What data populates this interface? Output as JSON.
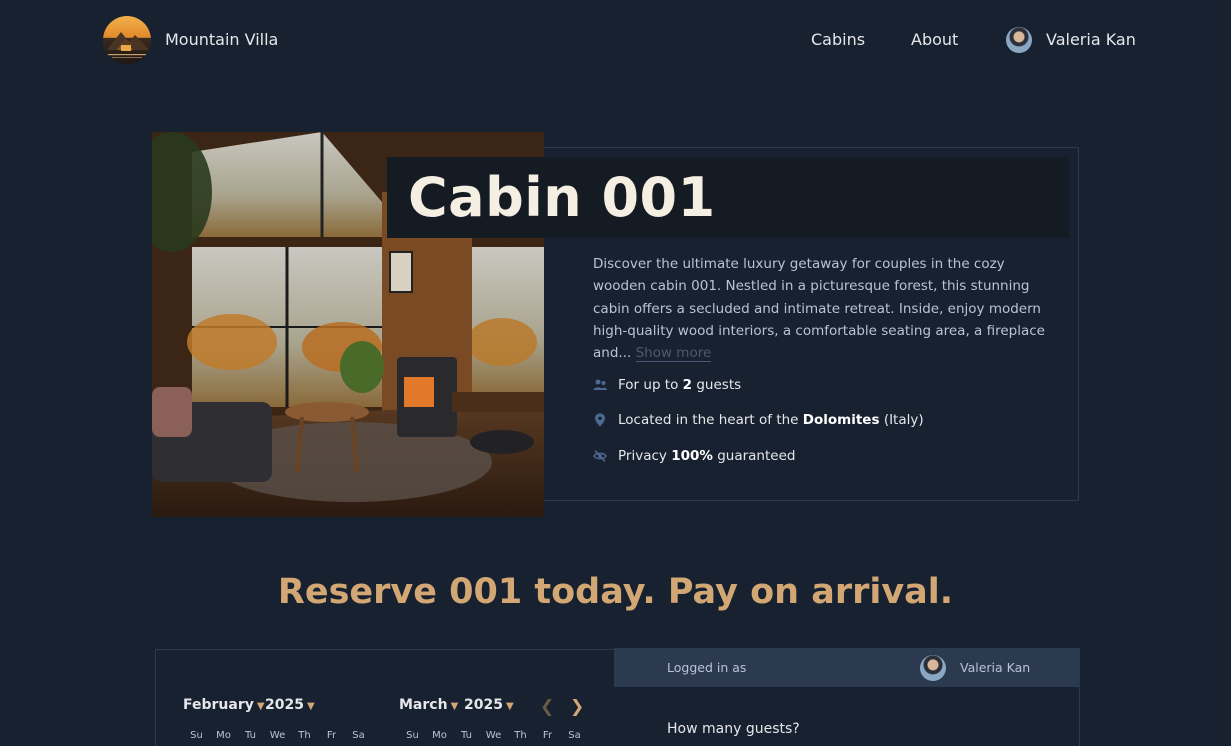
{
  "header": {
    "brand": "Mountain Villa",
    "nav": {
      "cabins": "Cabins",
      "about": "About"
    },
    "user_name": "Valeria Kan"
  },
  "cabin": {
    "title": "Cabin 001",
    "description": "Discover the ultimate luxury getaway for couples in the cozy wooden cabin 001. Nestled in a picturesque forest, this stunning cabin offers a secluded and intimate retreat. Inside, enjoy modern high-quality wood interiors, a comfortable seating area, a fireplace and...",
    "show_more": "Show more",
    "features": {
      "guests": {
        "prefix": "For up to",
        "value": "2",
        "suffix": "guests",
        "icon": "users-icon"
      },
      "location": {
        "prefix": "Located in the heart of the",
        "value": "Dolomites",
        "suffix": "(Italy)",
        "icon": "map-pin-icon"
      },
      "privacy": {
        "prefix": "Privacy",
        "value": "100%",
        "suffix": "guaranteed",
        "icon": "eye-slash-icon"
      }
    }
  },
  "reserve_heading": "Reserve 001 today. Pay on arrival.",
  "calendar": {
    "months": [
      {
        "month": "February",
        "year": "2025"
      },
      {
        "month": "March",
        "year": "2025"
      }
    ],
    "weekdays": [
      "Su",
      "Mo",
      "Tu",
      "We",
      "Th",
      "Fr",
      "Sa"
    ]
  },
  "booking": {
    "logged_in_label": "Logged in as",
    "user_name": "Valeria Kan",
    "guests_question": "How many guests?"
  },
  "colors": {
    "background": "#18212f",
    "accent": "#d2a774",
    "border": "#2c3a4f",
    "title_bar": "#141b22"
  }
}
